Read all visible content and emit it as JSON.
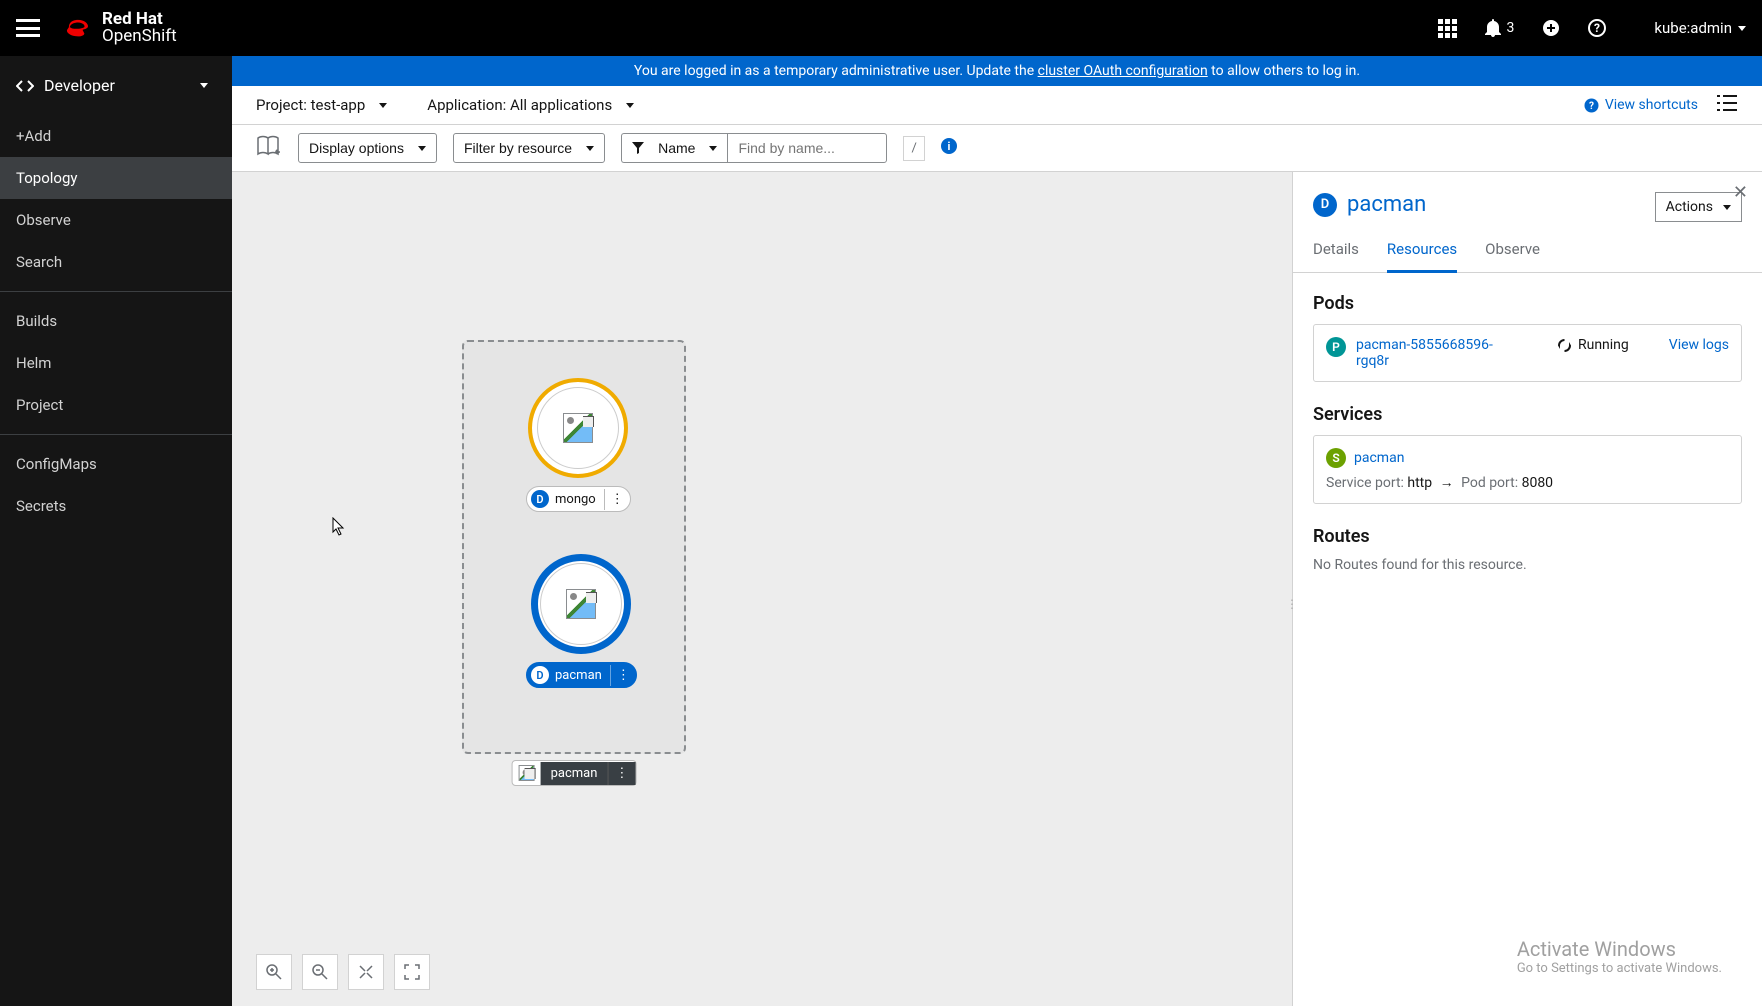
{
  "masthead": {
    "brand_line1": "Red Hat",
    "brand_line2": "OpenShift",
    "notification_count": "3",
    "user": "kube:admin"
  },
  "sidebar": {
    "perspective": "Developer",
    "items": [
      "+Add",
      "Topology",
      "Observe",
      "Search",
      "Builds",
      "Helm",
      "Project",
      "ConfigMaps",
      "Secrets"
    ],
    "selected_index": 1
  },
  "banner": {
    "pre": "You are logged in as a temporary administrative user. Update the ",
    "link": "cluster OAuth configuration",
    "post": " to allow others to log in."
  },
  "context": {
    "project_label": "Project: test-app",
    "app_label": "Application: All applications",
    "shortcuts": "View shortcuts"
  },
  "toolbar": {
    "display_options": "Display options",
    "filter_by_resource": "Filter by resource",
    "name_filter": "Name",
    "find_placeholder": "Find by name...",
    "slash": "/"
  },
  "topology": {
    "node1": {
      "badge": "D",
      "label": "mongo"
    },
    "node2": {
      "badge": "D",
      "label": "pacman"
    },
    "group": {
      "label": "pacman"
    }
  },
  "panel": {
    "badge": "D",
    "title": "pacman",
    "actions_label": "Actions",
    "tabs": [
      "Details",
      "Resources",
      "Observe"
    ],
    "active_tab": 1,
    "pods_heading": "Pods",
    "pod": {
      "badge": "P",
      "name": "pacman-5855668596-rgq8r",
      "status": "Running",
      "view_logs": "View logs"
    },
    "services_heading": "Services",
    "service": {
      "badge": "S",
      "name": "pacman",
      "port_label_pre": "Service port: ",
      "port_val1": "http",
      "arrow": "→",
      "port_label_mid": " Pod port: ",
      "port_val2": "8080"
    },
    "routes_heading": "Routes",
    "routes_empty": "No Routes found for this resource."
  },
  "watermark": {
    "l1": "Activate Windows",
    "l2": "Go to Settings to activate Windows."
  }
}
